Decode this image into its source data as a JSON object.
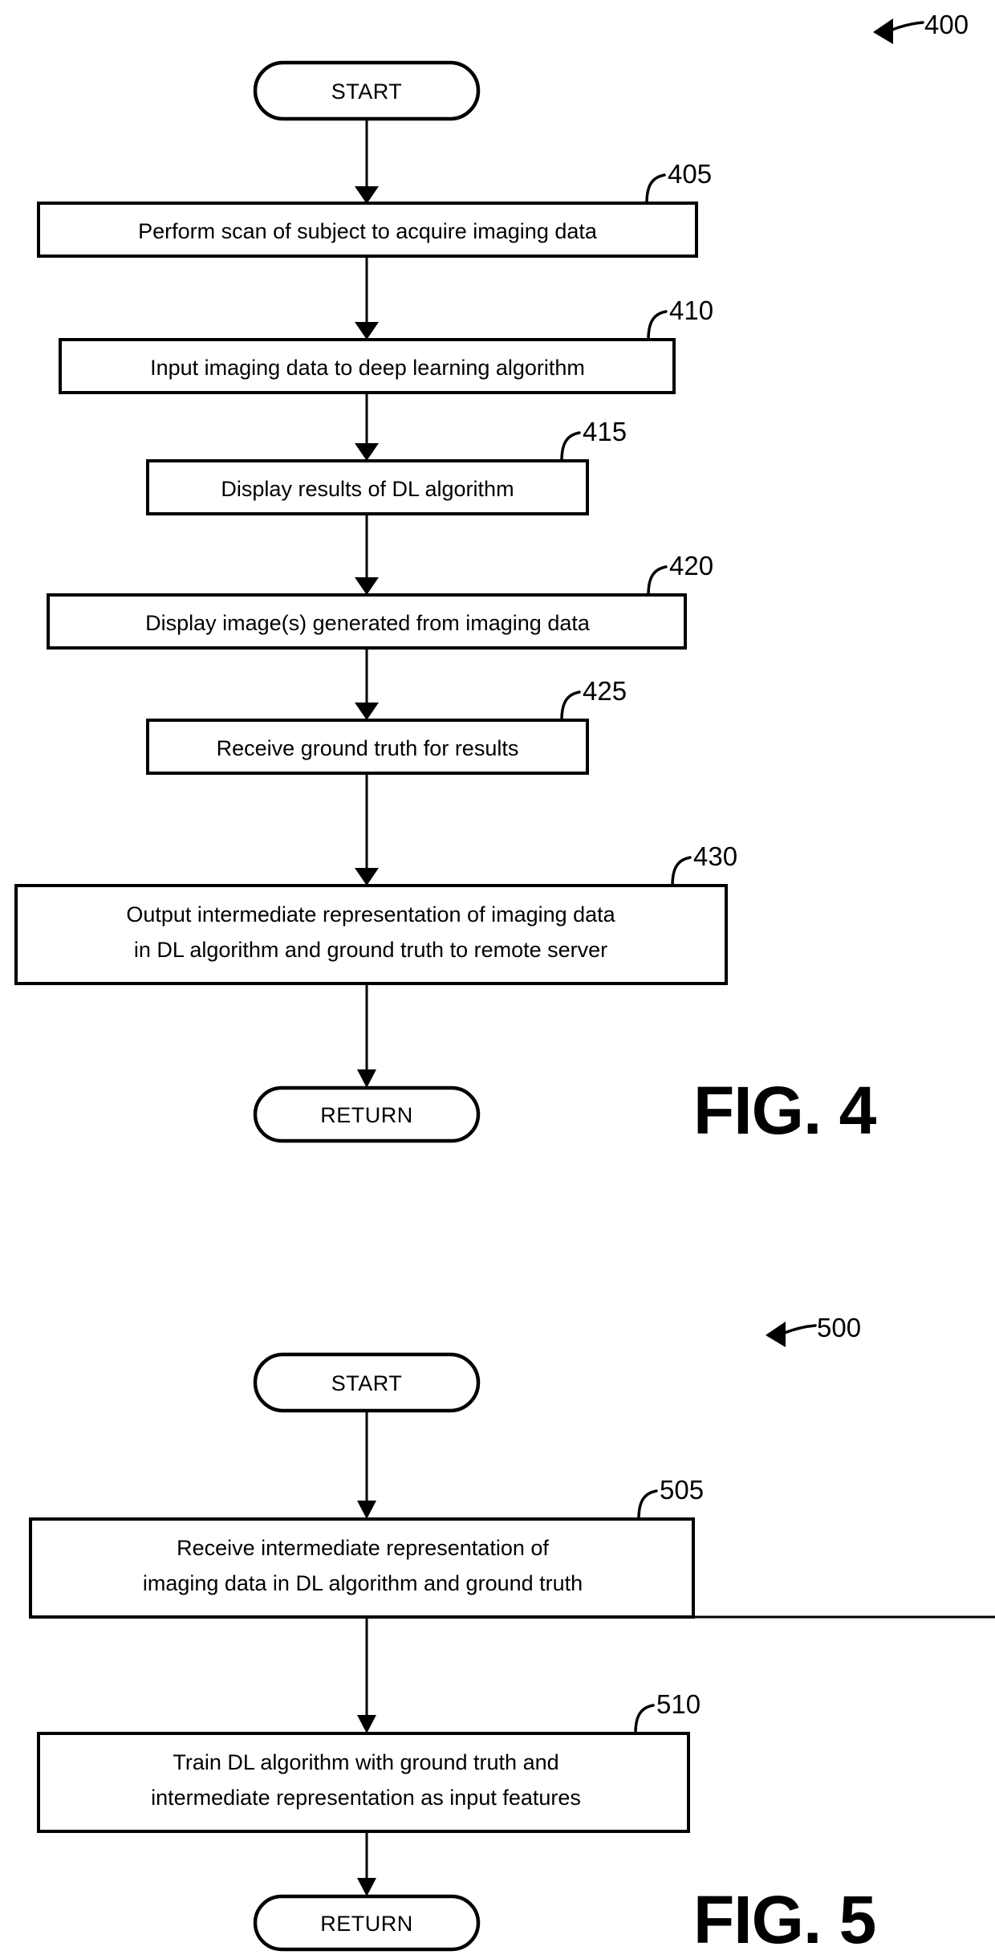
{
  "document": {
    "type": "patent-flowchart-sheet",
    "figures": [
      {
        "id": "fig4",
        "fig_label": "FIG. 4",
        "process_ref": "400",
        "start_label": "START",
        "end_label": "RETURN",
        "steps": [
          {
            "ref": "405",
            "lines": [
              "Perform scan of subject to acquire imaging data"
            ]
          },
          {
            "ref": "410",
            "lines": [
              "Input imaging data to deep learning algorithm"
            ]
          },
          {
            "ref": "415",
            "lines": [
              "Display results of DL algorithm"
            ]
          },
          {
            "ref": "420",
            "lines": [
              "Display image(s) generated from imaging data"
            ]
          },
          {
            "ref": "425",
            "lines": [
              "Receive ground truth for results"
            ]
          },
          {
            "ref": "430",
            "lines": [
              "Output intermediate representation of imaging data",
              "in DL algorithm and ground truth to remote server"
            ]
          }
        ]
      },
      {
        "id": "fig5",
        "fig_label": "FIG. 5",
        "process_ref": "500",
        "start_label": "START",
        "end_label": "RETURN",
        "steps": [
          {
            "ref": "505",
            "lines": [
              "Receive intermediate representation of",
              "imaging data in DL algorithm and ground truth"
            ]
          },
          {
            "ref": "510",
            "lines": [
              "Train DL algorithm with ground truth and",
              "intermediate representation as input features"
            ]
          }
        ]
      }
    ],
    "colors": {
      "ink": "#000000",
      "paper": "#ffffff"
    }
  }
}
